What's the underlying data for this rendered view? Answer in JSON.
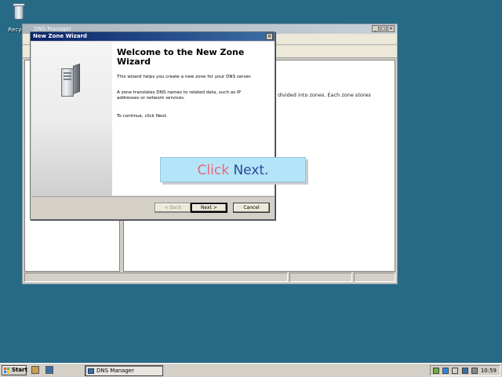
{
  "desktop": {
    "recycle_label": "Recycle"
  },
  "main_window": {
    "title": "DNS Manager",
    "btn_min": "_",
    "btn_max": "□",
    "btn_close": "×",
    "content_text": "e divided into zones. Each zone stores"
  },
  "wizard": {
    "title": "New Zone Wizard",
    "close": "×",
    "heading": "Welcome to the New Zone Wizard",
    "para1": "This wizard helps you create a new zone for your DNS server.",
    "para2": "A zone translates DNS names to related data, such as IP addresses or network services.",
    "para3": "To continue, click Next.",
    "back_label": "< Back",
    "next_label": "Next >",
    "cancel_label": "Cancel"
  },
  "callout": {
    "word1": "Click",
    "word2": "Next."
  },
  "taskbar": {
    "start_label": "Start",
    "task_label": "DNS Manager",
    "clock": "10:59"
  },
  "colors": {
    "desktop": "#276a86",
    "wizard_title": "#0a246a",
    "callout_bg": "#b4e4f8",
    "callout_word1": "#e8677a",
    "callout_word2": "#2a4a9a"
  }
}
